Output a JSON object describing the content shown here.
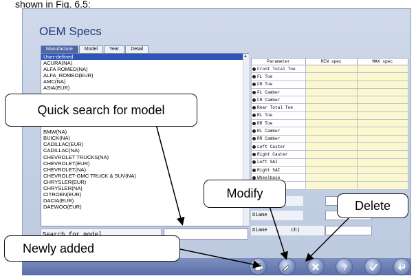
{
  "caption_fragment": "shown in Fig. 6.5:",
  "app": {
    "title": "OEM Specs",
    "tabs": [
      "Manufacture",
      "Model",
      "Year",
      "Detail"
    ],
    "manufacturers": [
      "User-defined",
      "ACURA(NA)",
      "ALFA ROMEO(NA)",
      "ALFA_ROMEO(EUR)",
      "AMC(NA)",
      "ASIA(EUR)",
      "",
      "",
      "",
      "",
      "",
      "",
      "BMW(NA)",
      "BUICK(NA)",
      "CADILLAC(EUR)",
      "CADILLAC(NA)",
      "CHEVROLET TRUCKS(NA)",
      "CHEVROLET(EUR)",
      "CHEVROLET(NA)",
      "CHEVROLET-GMC TRUCK & SUV(NA)",
      "CHRYSLER(EUR)",
      "CHRYSLER(NA)",
      "CITROEN(EUR)",
      "DACIA(EUR)",
      "DAEWOO(EUR)"
    ],
    "selected_index": 0,
    "search_label": "Search for model",
    "search_value": "",
    "table": {
      "headers": [
        "Parameter",
        "MIN spec",
        "MAX spec"
      ],
      "rows": [
        "Front Total Toe",
        "FL Toe",
        "FR Toe",
        "FL Camber",
        "FR Camber",
        "Rear Total Toe",
        "RL Toe",
        "RR Toe",
        "RL Camber",
        "RR Camber",
        "Left Caster",
        "Right Caster",
        "Left SAI",
        "Right SAI",
        "Wheelbase"
      ]
    },
    "extra_labels": [
      "Diam",
      "Diame",
      "Diame        ch)"
    ],
    "toolbar": {
      "add_key": "F1",
      "modify_key": "F5",
      "delete_key": "F6",
      "help_key": "F7",
      "ok_key": "F9",
      "back_key": "ESC"
    }
  },
  "callouts": {
    "quick_search": "Quick search for model",
    "modify": "Modify",
    "delete": "Delete",
    "newly_added": "Newly added"
  }
}
